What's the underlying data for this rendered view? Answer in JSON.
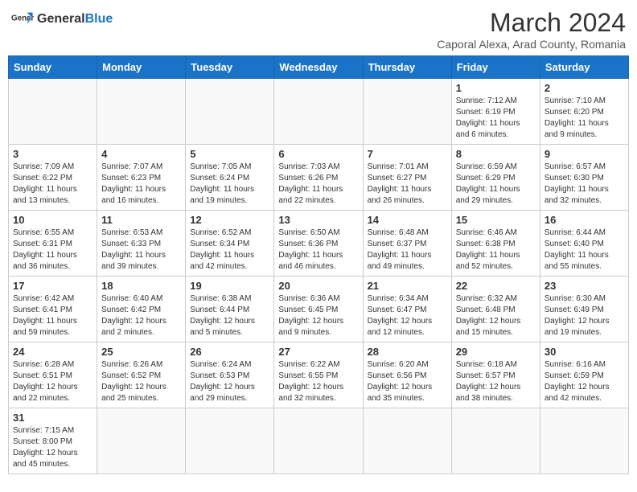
{
  "header": {
    "logo_general": "General",
    "logo_blue": "Blue",
    "title": "March 2024",
    "subtitle": "Caporal Alexa, Arad County, Romania"
  },
  "days_of_week": [
    "Sunday",
    "Monday",
    "Tuesday",
    "Wednesday",
    "Thursday",
    "Friday",
    "Saturday"
  ],
  "weeks": [
    [
      {
        "day": "",
        "info": ""
      },
      {
        "day": "",
        "info": ""
      },
      {
        "day": "",
        "info": ""
      },
      {
        "day": "",
        "info": ""
      },
      {
        "day": "",
        "info": ""
      },
      {
        "day": "1",
        "info": "Sunrise: 7:12 AM\nSunset: 6:19 PM\nDaylight: 11 hours\nand 6 minutes."
      },
      {
        "day": "2",
        "info": "Sunrise: 7:10 AM\nSunset: 6:20 PM\nDaylight: 11 hours\nand 9 minutes."
      }
    ],
    [
      {
        "day": "3",
        "info": "Sunrise: 7:09 AM\nSunset: 6:22 PM\nDaylight: 11 hours\nand 13 minutes."
      },
      {
        "day": "4",
        "info": "Sunrise: 7:07 AM\nSunset: 6:23 PM\nDaylight: 11 hours\nand 16 minutes."
      },
      {
        "day": "5",
        "info": "Sunrise: 7:05 AM\nSunset: 6:24 PM\nDaylight: 11 hours\nand 19 minutes."
      },
      {
        "day": "6",
        "info": "Sunrise: 7:03 AM\nSunset: 6:26 PM\nDaylight: 11 hours\nand 22 minutes."
      },
      {
        "day": "7",
        "info": "Sunrise: 7:01 AM\nSunset: 6:27 PM\nDaylight: 11 hours\nand 26 minutes."
      },
      {
        "day": "8",
        "info": "Sunrise: 6:59 AM\nSunset: 6:29 PM\nDaylight: 11 hours\nand 29 minutes."
      },
      {
        "day": "9",
        "info": "Sunrise: 6:57 AM\nSunset: 6:30 PM\nDaylight: 11 hours\nand 32 minutes."
      }
    ],
    [
      {
        "day": "10",
        "info": "Sunrise: 6:55 AM\nSunset: 6:31 PM\nDaylight: 11 hours\nand 36 minutes."
      },
      {
        "day": "11",
        "info": "Sunrise: 6:53 AM\nSunset: 6:33 PM\nDaylight: 11 hours\nand 39 minutes."
      },
      {
        "day": "12",
        "info": "Sunrise: 6:52 AM\nSunset: 6:34 PM\nDaylight: 11 hours\nand 42 minutes."
      },
      {
        "day": "13",
        "info": "Sunrise: 6:50 AM\nSunset: 6:36 PM\nDaylight: 11 hours\nand 46 minutes."
      },
      {
        "day": "14",
        "info": "Sunrise: 6:48 AM\nSunset: 6:37 PM\nDaylight: 11 hours\nand 49 minutes."
      },
      {
        "day": "15",
        "info": "Sunrise: 6:46 AM\nSunset: 6:38 PM\nDaylight: 11 hours\nand 52 minutes."
      },
      {
        "day": "16",
        "info": "Sunrise: 6:44 AM\nSunset: 6:40 PM\nDaylight: 11 hours\nand 55 minutes."
      }
    ],
    [
      {
        "day": "17",
        "info": "Sunrise: 6:42 AM\nSunset: 6:41 PM\nDaylight: 11 hours\nand 59 minutes."
      },
      {
        "day": "18",
        "info": "Sunrise: 6:40 AM\nSunset: 6:42 PM\nDaylight: 12 hours\nand 2 minutes."
      },
      {
        "day": "19",
        "info": "Sunrise: 6:38 AM\nSunset: 6:44 PM\nDaylight: 12 hours\nand 5 minutes."
      },
      {
        "day": "20",
        "info": "Sunrise: 6:36 AM\nSunset: 6:45 PM\nDaylight: 12 hours\nand 9 minutes."
      },
      {
        "day": "21",
        "info": "Sunrise: 6:34 AM\nSunset: 6:47 PM\nDaylight: 12 hours\nand 12 minutes."
      },
      {
        "day": "22",
        "info": "Sunrise: 6:32 AM\nSunset: 6:48 PM\nDaylight: 12 hours\nand 15 minutes."
      },
      {
        "day": "23",
        "info": "Sunrise: 6:30 AM\nSunset: 6:49 PM\nDaylight: 12 hours\nand 19 minutes."
      }
    ],
    [
      {
        "day": "24",
        "info": "Sunrise: 6:28 AM\nSunset: 6:51 PM\nDaylight: 12 hours\nand 22 minutes."
      },
      {
        "day": "25",
        "info": "Sunrise: 6:26 AM\nSunset: 6:52 PM\nDaylight: 12 hours\nand 25 minutes."
      },
      {
        "day": "26",
        "info": "Sunrise: 6:24 AM\nSunset: 6:53 PM\nDaylight: 12 hours\nand 29 minutes."
      },
      {
        "day": "27",
        "info": "Sunrise: 6:22 AM\nSunset: 6:55 PM\nDaylight: 12 hours\nand 32 minutes."
      },
      {
        "day": "28",
        "info": "Sunrise: 6:20 AM\nSunset: 6:56 PM\nDaylight: 12 hours\nand 35 minutes."
      },
      {
        "day": "29",
        "info": "Sunrise: 6:18 AM\nSunset: 6:57 PM\nDaylight: 12 hours\nand 38 minutes."
      },
      {
        "day": "30",
        "info": "Sunrise: 6:16 AM\nSunset: 6:59 PM\nDaylight: 12 hours\nand 42 minutes."
      }
    ],
    [
      {
        "day": "31",
        "info": "Sunrise: 7:15 AM\nSunset: 8:00 PM\nDaylight: 12 hours\nand 45 minutes."
      },
      {
        "day": "",
        "info": ""
      },
      {
        "day": "",
        "info": ""
      },
      {
        "day": "",
        "info": ""
      },
      {
        "day": "",
        "info": ""
      },
      {
        "day": "",
        "info": ""
      },
      {
        "day": "",
        "info": ""
      }
    ]
  ]
}
